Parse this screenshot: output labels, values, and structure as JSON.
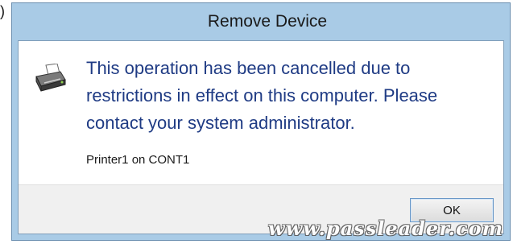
{
  "step_marker": ")",
  "dialog": {
    "title": "Remove Device",
    "icon": "printer-warning-icon",
    "message": "This operation has been cancelled due to restrictions in effect on this computer. Please contact your system administrator.",
    "detail": "Printer1 on CONT1",
    "ok_label": "OK"
  },
  "watermark": "www.passleader.com",
  "colors": {
    "frame": "#a9cbe6",
    "message_text": "#1f3b84",
    "button_bar": "#f0f0f0"
  }
}
